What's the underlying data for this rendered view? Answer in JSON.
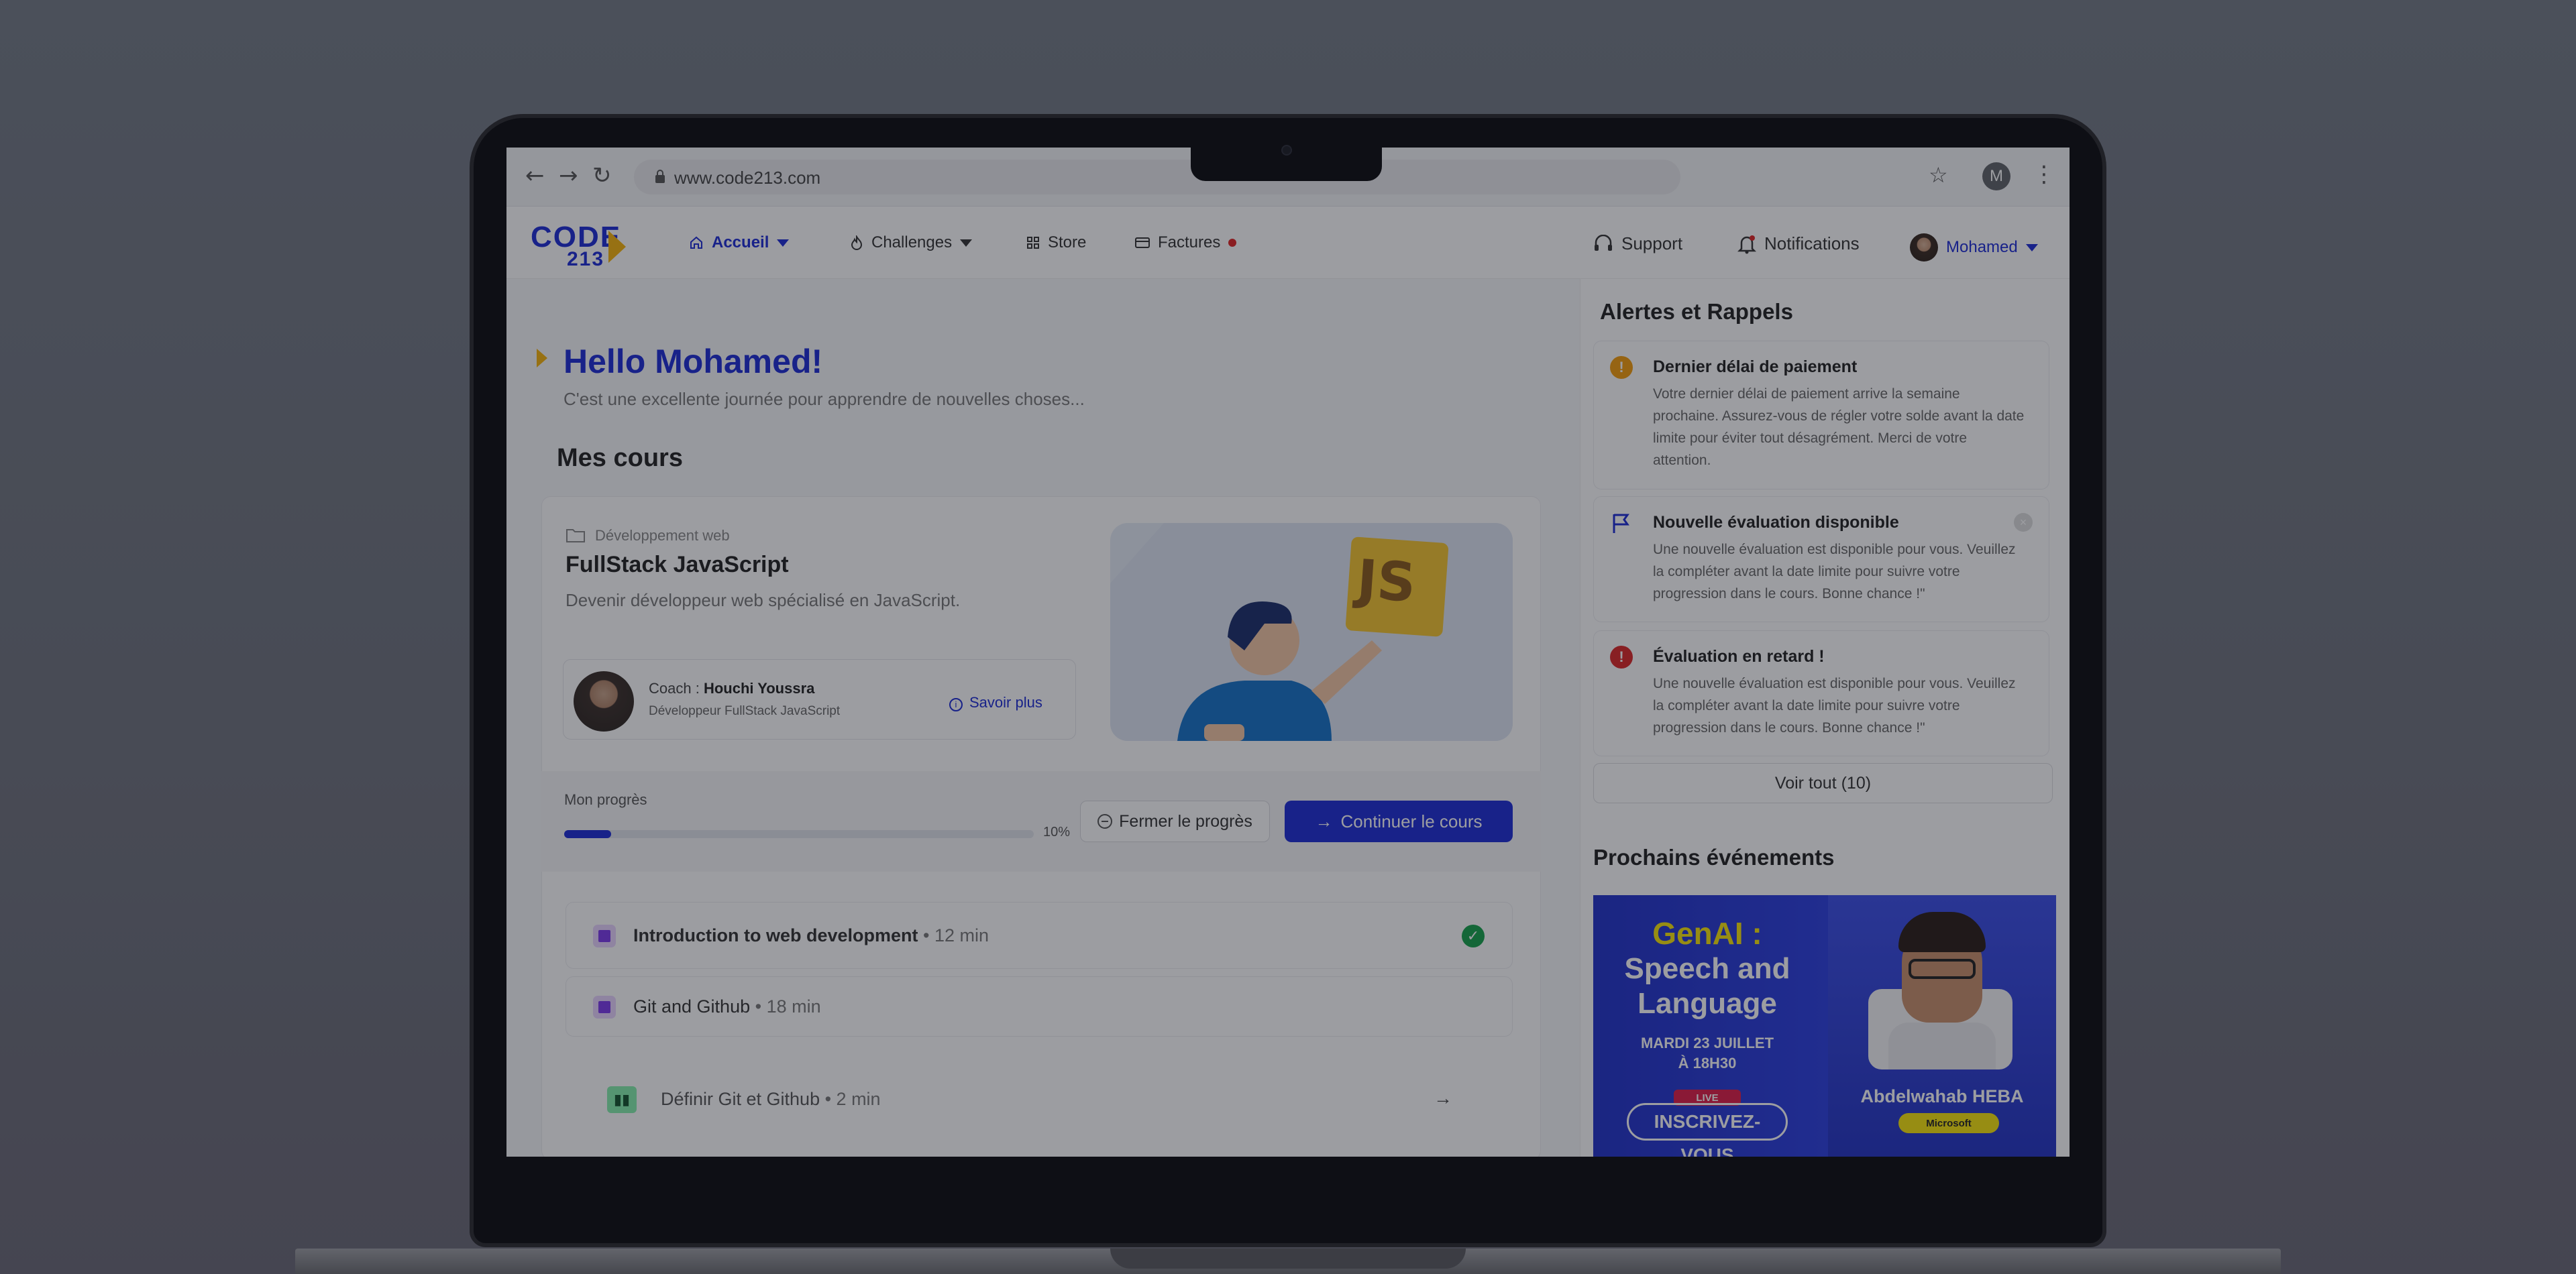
{
  "browser": {
    "url": "www.code213.com",
    "profile_initial": "M"
  },
  "brand": {
    "logo_top": "CODE",
    "logo_bottom": "213",
    "accent": "#1d2bd6",
    "highlight": "#f6b40c"
  },
  "nav": {
    "items": [
      {
        "label": "Accueil",
        "icon": "home-icon"
      },
      {
        "label": "Challenges",
        "icon": "flame-icon"
      },
      {
        "label": "Store",
        "icon": "grid-icon"
      },
      {
        "label": "Factures",
        "icon": "invoice-icon"
      }
    ],
    "support": "Support",
    "notifications": "Notifications",
    "user": "Mohamed"
  },
  "hero": {
    "greeting": "Hello Mohamed!",
    "subtitle": "C'est une excellente journée pour apprendre de nouvelles choses..."
  },
  "courses": {
    "heading": "Mes cours",
    "category": "Développement web",
    "title": "FullStack JavaScript",
    "description": "Devenir développeur web spécialisé en JavaScript.",
    "coach_prefix": "Coach : ",
    "coach_name": "Houchi Youssra",
    "coach_role": "Développeur FullStack JavaScript",
    "learn_more": "Savoir plus",
    "illustration_badge": "JS",
    "progress_label": "Mon progrès",
    "progress_value": 10,
    "progress_text": "10%",
    "close_progress": "Fermer le progrès",
    "continue": "Continuer le cours",
    "lessons": [
      {
        "title": "Introduction to web development",
        "duration": " • 12 min",
        "completed": true
      },
      {
        "title": "Git and Github",
        "duration": " • 18 min",
        "completed": false
      }
    ],
    "sublesson": {
      "title": "Définir Git et Github",
      "duration": " • 2 min"
    }
  },
  "alerts": {
    "heading": "Alertes et Rappels",
    "items": [
      {
        "title": "Dernier délai de paiement",
        "text": "Votre dernier délai de paiement arrive la semaine prochaine. Assurez-vous de régler votre solde avant la date limite pour éviter tout désagrément. Merci de votre attention.",
        "icon": "warning-icon",
        "color": "#f59e0b"
      },
      {
        "title": "Nouvelle évaluation disponible",
        "text": "Une nouvelle évaluation est disponible pour vous. Veuillez la compléter avant la date limite pour suivre votre progression dans le cours. Bonne chance !\"",
        "icon": "flag-icon",
        "color": "#1d2bd6"
      },
      {
        "title": "Évaluation en retard !",
        "text": "Une nouvelle évaluation est disponible pour vous. Veuillez la compléter avant la date limite pour suivre votre progression dans le cours. Bonne chance !\"",
        "icon": "error-icon",
        "color": "#dc2626"
      }
    ],
    "see_all": "Voir tout (10)"
  },
  "events": {
    "heading": "Prochains événements",
    "banner": {
      "line1": "GenAI :",
      "line2": "Speech and",
      "line3": "Language",
      "date": "MARDI 23 JUILLET",
      "time": "À 18H30",
      "live": "LIVE",
      "cta": "INSCRIVEZ-VOUS",
      "speaker": "Abdelwahab HEBA",
      "badge": "Microsoft"
    }
  }
}
